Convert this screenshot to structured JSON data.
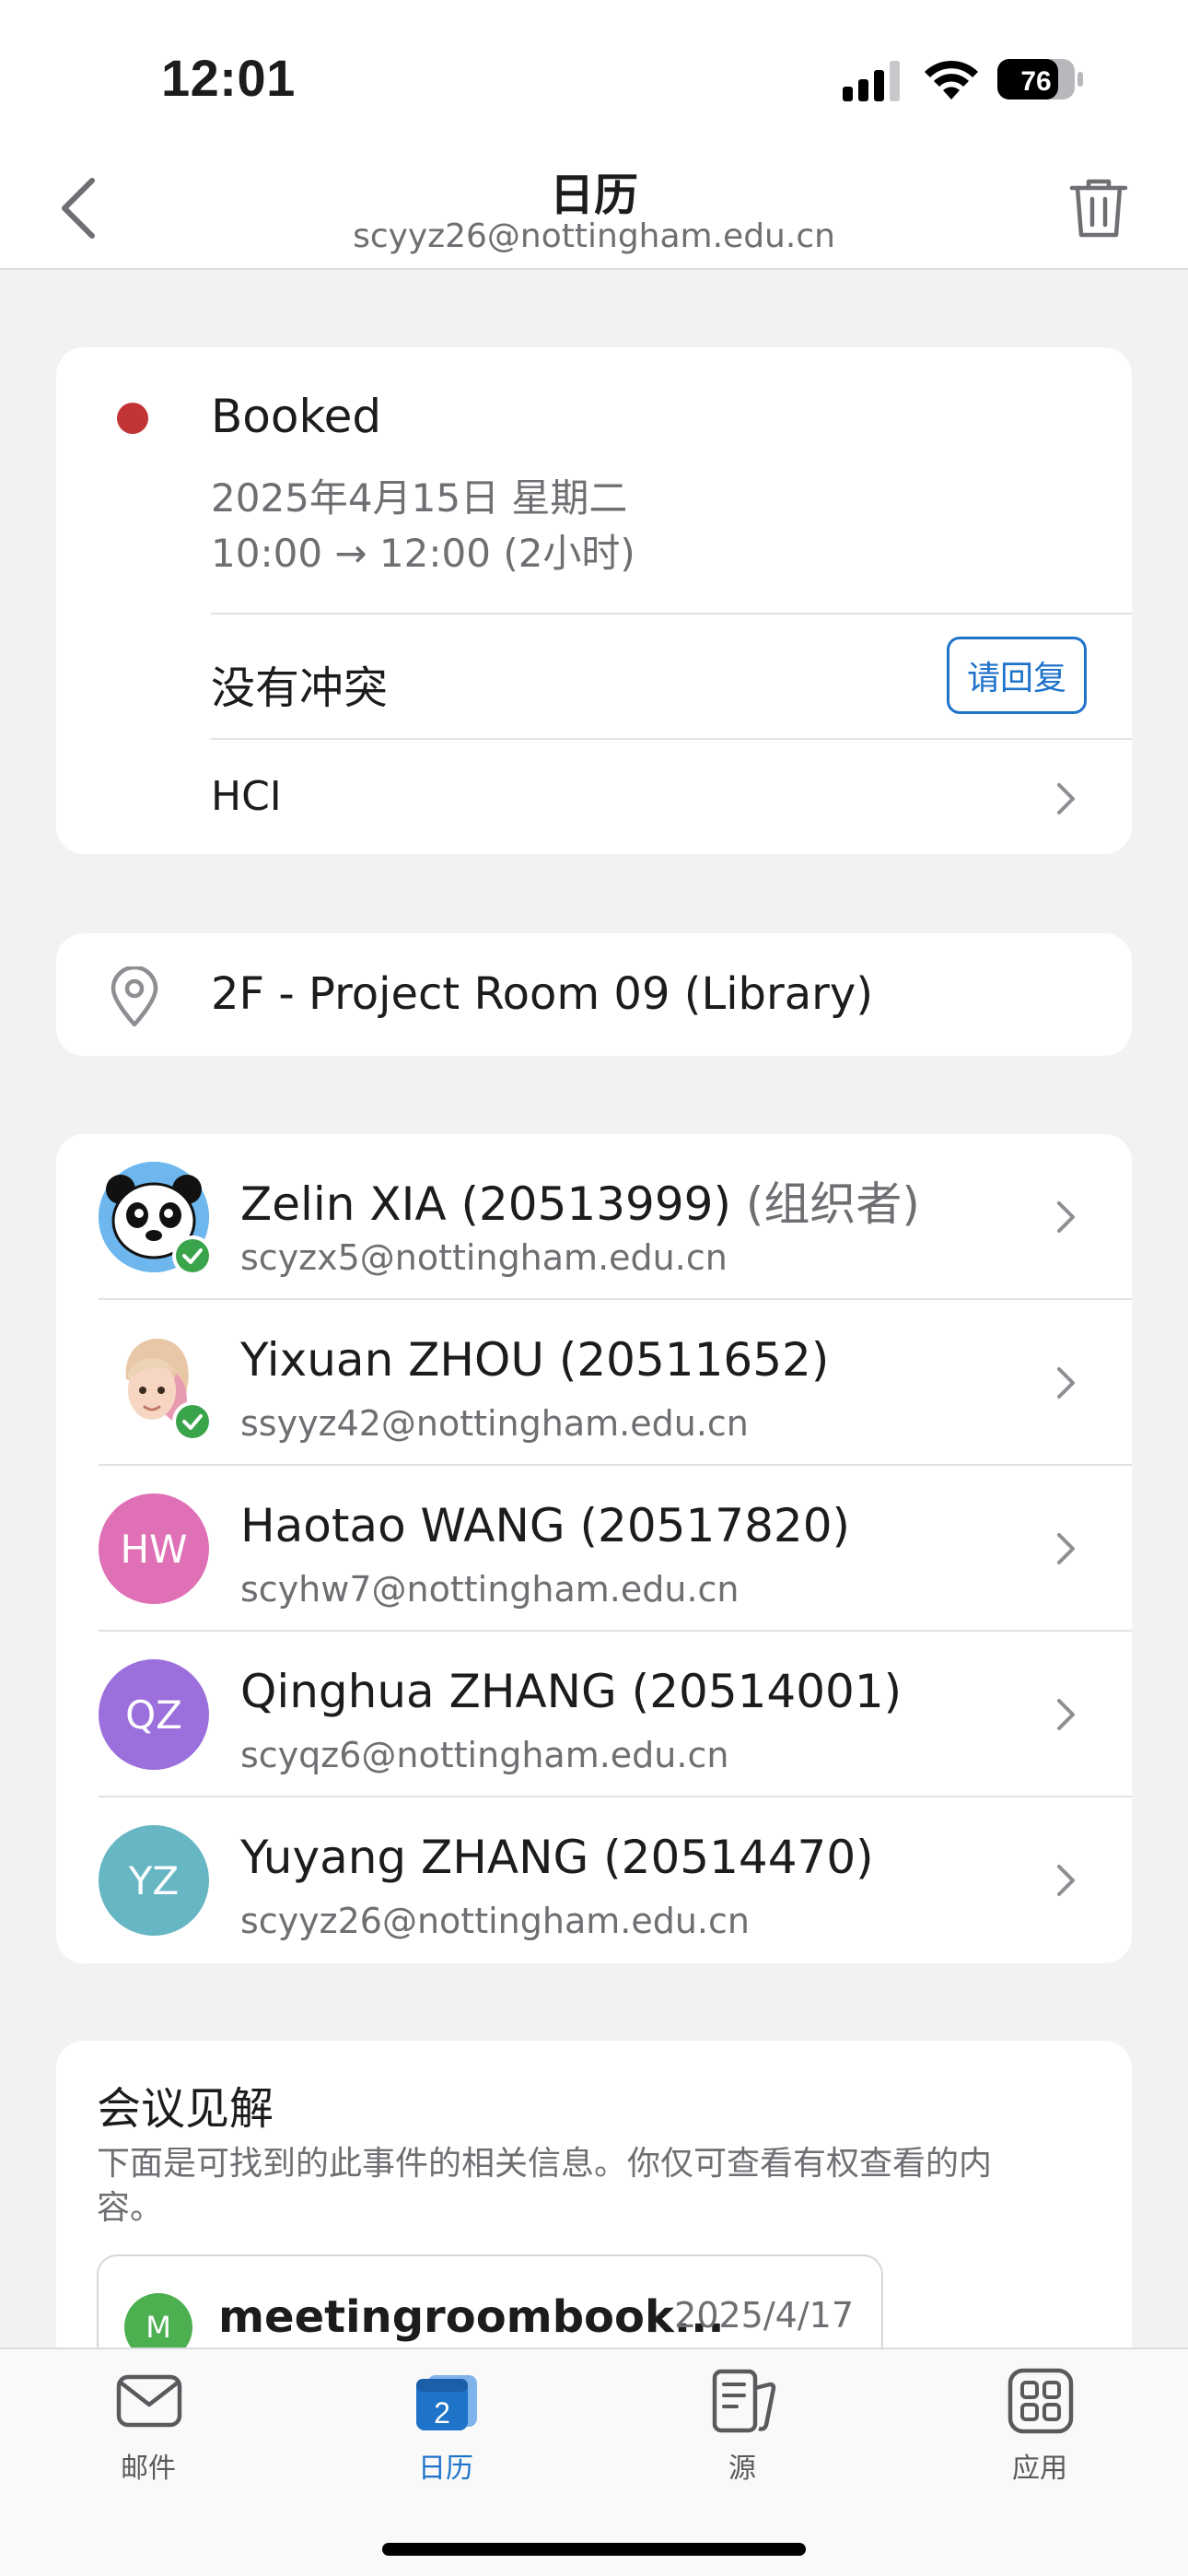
{
  "status_bar": {
    "time": "12:01",
    "battery": "76",
    "icons": [
      "cellular-signal-icon",
      "wifi-icon",
      "battery-icon"
    ]
  },
  "header": {
    "title": "日历",
    "subtitle": "scyyz26@nottingham.edu.cn",
    "back_icon": "chevron-left-icon",
    "delete_icon": "trash-icon"
  },
  "event": {
    "title": "Booked",
    "date": "2025年4月15日 星期二",
    "time": "10:00 → 12:00 (2小时)",
    "conflict": "没有冲突",
    "rsvp_label": "请回复",
    "category": "HCI",
    "status_color": "#c23435"
  },
  "location": {
    "text": "2F - Project Room 09 (Library)",
    "icon": "location-pin-icon"
  },
  "attendees": [
    {
      "name": "Zelin XIA (20513999)",
      "role": "(组织者)",
      "email": "scyzx5@nottingham.edu.cn",
      "avatar_type": "panda-image",
      "accepted": true
    },
    {
      "name": "Yixuan ZHOU (20511652)",
      "role": "",
      "email": "ssyyz42@nottingham.edu.cn",
      "avatar_type": "memoji-image",
      "accepted": true
    },
    {
      "name": "Haotao WANG (20517820)",
      "role": "",
      "email": "scyhw7@nottingham.edu.cn",
      "initials": "HW",
      "color": "#e070b5",
      "accepted": false
    },
    {
      "name": "Qinghua ZHANG (20514001)",
      "role": "",
      "email": "scyqz6@nottingham.edu.cn",
      "initials": "QZ",
      "color": "#9b6fdc",
      "accepted": false
    },
    {
      "name": "Yuyang ZHANG (20514470)",
      "role": "",
      "email": "scyyz26@nottingham.edu.cn",
      "initials": "YZ",
      "color": "#67b6c3",
      "accepted": false
    }
  ],
  "insights": {
    "title": "会议见解",
    "description": "下面是可找到的此事件的相关信息。你仅可查看有权查看的内容。",
    "items": [
      {
        "avatar": "M",
        "title": "meetingroombook...",
        "date": "2025/4/17",
        "color": "#4caf50"
      }
    ]
  },
  "tabbar": {
    "tabs": [
      {
        "label": "邮件",
        "icon": "mail-icon",
        "active": false
      },
      {
        "label": "日历",
        "icon": "calendar-icon",
        "badge": "2",
        "active": true
      },
      {
        "label": "源",
        "icon": "feed-icon",
        "active": false
      },
      {
        "label": "应用",
        "icon": "apps-grid-icon",
        "active": false
      }
    ],
    "accent": "#1f73c9"
  }
}
